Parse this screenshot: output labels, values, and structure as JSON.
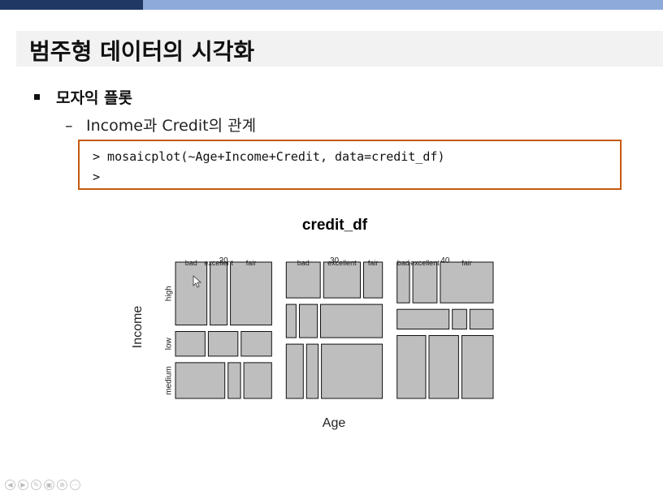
{
  "slide": {
    "title": "범주형 데이터의 시각화",
    "bullet1": "모자익 플롯",
    "bullet2_dash": "–",
    "bullet2": "Income과 Credit의 관계"
  },
  "code": {
    "line1": "> mosaicplot(~Age+Income+Credit, data=credit_df)",
    "line2": ">"
  },
  "colors": {
    "accent_dark": "#1f3864",
    "accent_light": "#8eaadb",
    "code_border": "#c55a11",
    "tile_fill": "#bebebe"
  },
  "chart_data": {
    "type": "mosaic",
    "title": "credit_df",
    "xlabel": "Age",
    "ylabel": "Income",
    "age_levels": [
      "20",
      "30",
      "40"
    ],
    "income_levels": [
      "high",
      "low",
      "medium"
    ],
    "credit_levels": [
      "bad",
      "excellent",
      "fair"
    ],
    "age_groups": [
      {
        "age": "20",
        "credit_labels": [
          "bad",
          "excellent",
          "fair"
        ],
        "income_fractions": [
          0.51,
          0.2,
          0.29
        ],
        "credit_fractions": [
          [
            0.35,
            0.19,
            0.46
          ],
          [
            0.33,
            0.33,
            0.34
          ],
          [
            0.55,
            0.14,
            0.31
          ]
        ]
      },
      {
        "age": "30",
        "credit_labels": [
          "bad",
          "excellent",
          "fair"
        ],
        "income_fractions": [
          0.29,
          0.27,
          0.44
        ],
        "credit_fractions": [
          [
            0.38,
            0.41,
            0.21
          ],
          [
            0.11,
            0.2,
            0.69
          ],
          [
            0.19,
            0.13,
            0.68
          ]
        ]
      },
      {
        "age": "40",
        "credit_labels": [
          "bad",
          "excellent",
          "fair"
        ],
        "income_fractions": [
          0.33,
          0.16,
          0.51
        ],
        "credit_fractions": [
          [
            0.14,
            0.27,
            0.59
          ],
          [
            0.58,
            0.16,
            0.26
          ],
          [
            0.32,
            0.33,
            0.35
          ]
        ]
      }
    ]
  }
}
